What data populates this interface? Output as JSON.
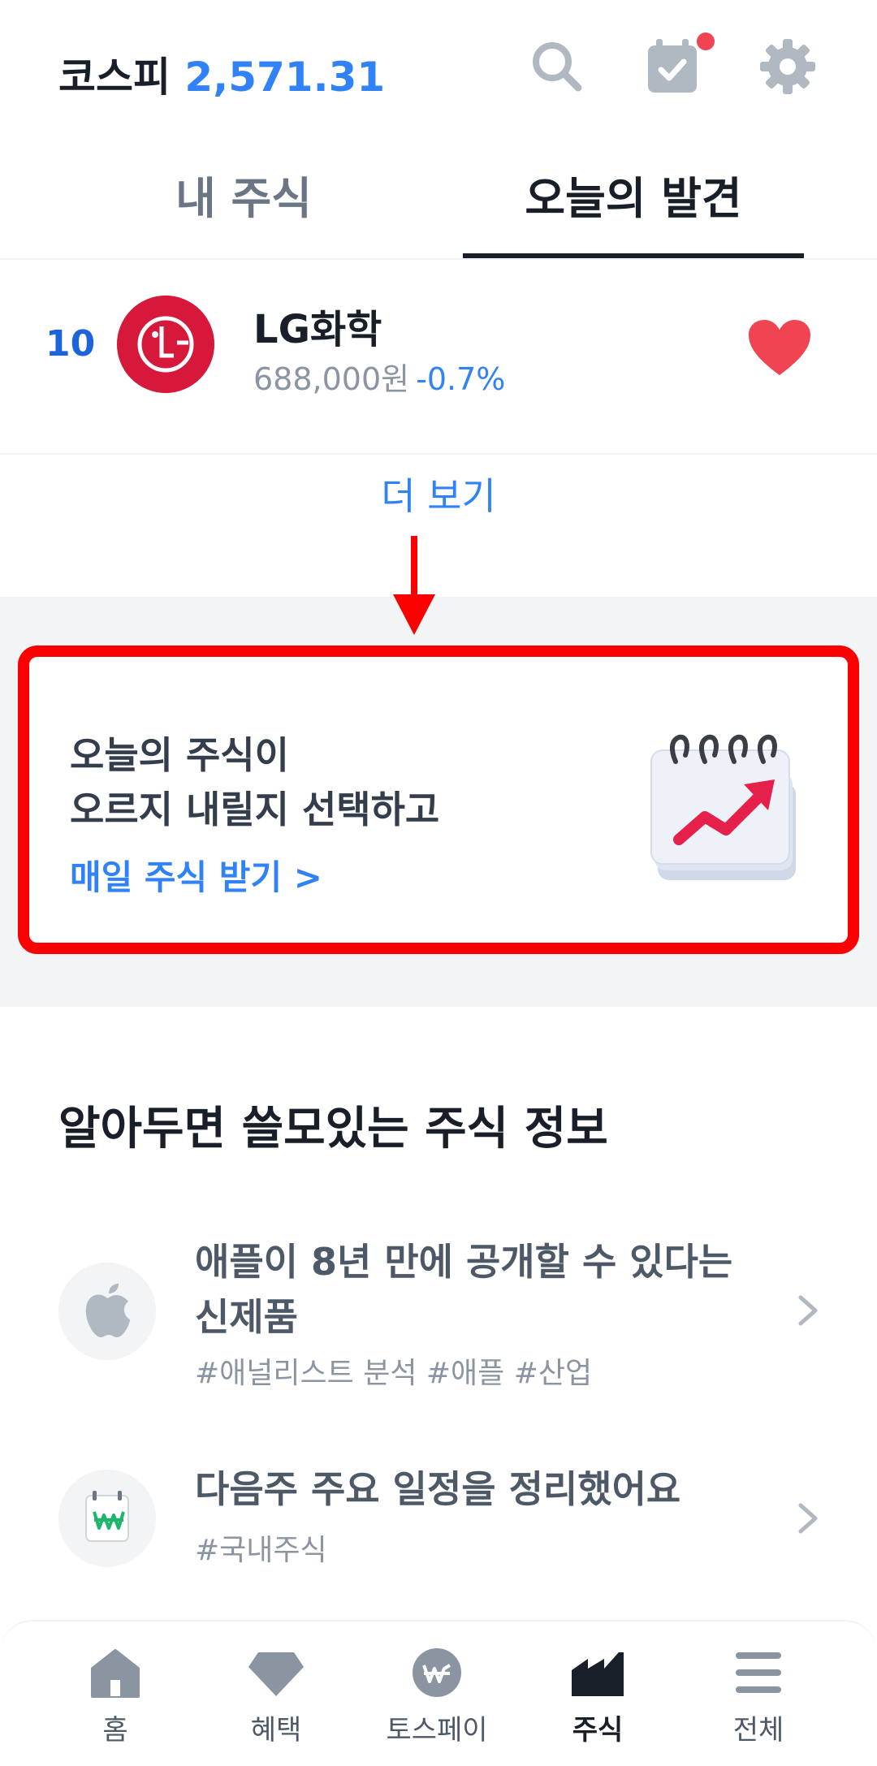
{
  "header": {
    "index_label": "코스피",
    "index_value": "2,571.31",
    "icons": [
      "search-icon",
      "calendar-check-icon",
      "gear-icon"
    ],
    "notification_dot": true
  },
  "tabs": [
    {
      "label": "내 주식",
      "active": false
    },
    {
      "label": "오늘의 발견",
      "active": true
    }
  ],
  "stock_row": {
    "rank": "10",
    "name": "LG화학",
    "price": "688,000원",
    "change": "-0.7%",
    "favorited": true
  },
  "more_label": "더 보기",
  "banner": {
    "line1": "오늘의 주식이",
    "line2": "오르지 내릴지 선택하고",
    "cta": "매일 주식 받기 >"
  },
  "info_section": {
    "title": "알아두면 쓸모있는 주식 정보",
    "items": [
      {
        "title": "애플이 8년 만에 공개할 수 있다는 신제품",
        "tags": "#애널리스트 분석 #애플 #산업",
        "icon": "apple-logo-icon"
      },
      {
        "title": "다음주 주요 일정을 정리했어요",
        "tags": "#국내주식",
        "icon": "won-calendar-icon"
      }
    ]
  },
  "bottom_nav": [
    {
      "label": "홈",
      "icon": "home-icon",
      "active": false
    },
    {
      "label": "혜택",
      "icon": "diamond-icon",
      "active": false
    },
    {
      "label": "토스페이",
      "icon": "won-coin-icon",
      "active": false
    },
    {
      "label": "주식",
      "icon": "chart-icon",
      "active": true
    },
    {
      "label": "전체",
      "icon": "menu-icon",
      "active": false
    }
  ],
  "colors": {
    "accent": "#3182f6",
    "rank_blue": "#1b64da",
    "highlight_red": "#fb0000",
    "heart_red": "#f04452",
    "lg_red": "#d6193a"
  }
}
